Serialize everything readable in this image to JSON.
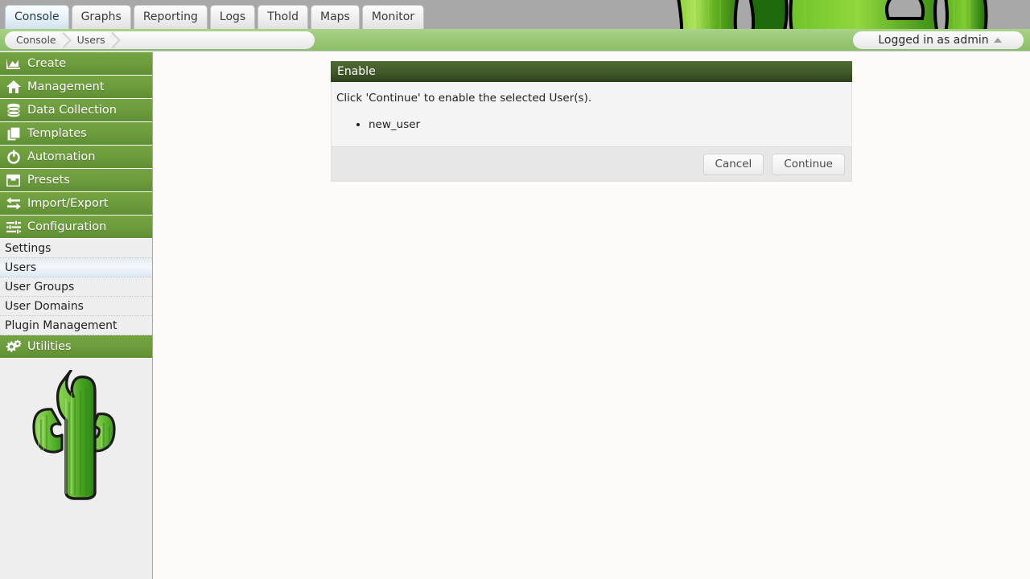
{
  "colors": {
    "nav_green": "#6D9C3D",
    "crumb_green": "#98C773",
    "dialog_header": "#41592A",
    "tabbar_gray": "#A8A8A8",
    "content_bg": "#FDFAF7",
    "sidebar_bg": "#EEEEEE",
    "selected_blue": "#E2EAF0"
  },
  "tabs": [
    {
      "label": "Console",
      "active": true
    },
    {
      "label": "Graphs",
      "active": false
    },
    {
      "label": "Reporting",
      "active": false
    },
    {
      "label": "Logs",
      "active": false
    },
    {
      "label": "Thold",
      "active": false
    },
    {
      "label": "Maps",
      "active": false
    },
    {
      "label": "Monitor",
      "active": false
    }
  ],
  "banner": {
    "icon": "cactus-banner-image"
  },
  "breadcrumb": {
    "items": [
      {
        "label": "Console"
      },
      {
        "label": "Users"
      }
    ]
  },
  "user_menu": {
    "label": "Logged in as admin",
    "icon": "caret-up-icon"
  },
  "sidebar": {
    "sections": [
      {
        "label": "Create",
        "icon": "chart-area-icon"
      },
      {
        "label": "Management",
        "icon": "home-icon"
      },
      {
        "label": "Data Collection",
        "icon": "database-icon"
      },
      {
        "label": "Templates",
        "icon": "copy-pages-icon"
      },
      {
        "label": "Automation",
        "icon": "refresh-circle-icon"
      },
      {
        "label": "Presets",
        "icon": "archive-box-icon"
      },
      {
        "label": "Import/Export",
        "icon": "exchange-arrows-icon"
      },
      {
        "label": "Configuration",
        "icon": "sliders-icon"
      }
    ],
    "subitems": [
      {
        "label": "Settings",
        "selected": false
      },
      {
        "label": "Users",
        "selected": true
      },
      {
        "label": "User Groups",
        "selected": false
      },
      {
        "label": "User Domains",
        "selected": false
      },
      {
        "label": "Plugin Management",
        "selected": false
      }
    ],
    "utilities": {
      "label": "Utilities",
      "icon": "gears-icon"
    },
    "logo": {
      "icon": "cactus-logo"
    }
  },
  "dialog": {
    "title": "Enable",
    "message": "Click 'Continue' to enable the selected User(s).",
    "items": [
      "new_user"
    ],
    "buttons": {
      "cancel": "Cancel",
      "continue": "Continue"
    }
  }
}
